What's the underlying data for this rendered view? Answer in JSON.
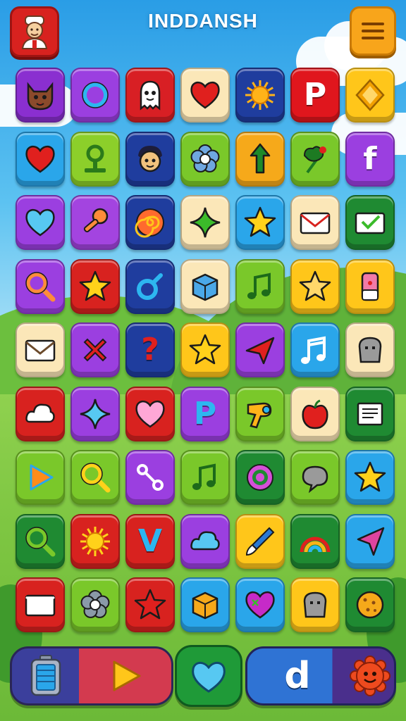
{
  "header": {
    "title": "INDDANSH",
    "avatar_icon": "chef-avatar-icon",
    "menu_icon": "hamburger-menu-icon"
  },
  "grid": {
    "rows": [
      [
        {
          "name": "cat-face",
          "bg": "#8a2fd0",
          "fg": "#8b4a2b"
        },
        {
          "name": "ring",
          "bg": "#9b3fe0",
          "fg": "#2db6f0"
        },
        {
          "name": "ghost-face",
          "bg": "#d81f24",
          "fg": "#ffffff"
        },
        {
          "name": "heart",
          "bg": "#fbe7b8",
          "fg": "#e0201e"
        },
        {
          "name": "sun",
          "bg": "#1f3d9e",
          "fg": "#ffb319"
        },
        {
          "name": "letter-p",
          "bg": "#e0161d",
          "fg": "#ffffff",
          "text": "P"
        },
        {
          "name": "diamond",
          "bg": "#ffc61a",
          "fg": "#f2a000"
        }
      ],
      [
        {
          "name": "heart",
          "bg": "#2aa6ea",
          "fg": "#e0201e"
        },
        {
          "name": "signpost",
          "bg": "#8ccf2a",
          "fg": "#2b7a1a"
        },
        {
          "name": "boy-face",
          "bg": "#1f3d9e",
          "fg": "#f1c27d"
        },
        {
          "name": "flower",
          "bg": "#7ac82a",
          "fg": "#6fa7e0"
        },
        {
          "name": "arrow-up",
          "bg": "#f6a91a",
          "fg": "#1e8a2a"
        },
        {
          "name": "rose",
          "bg": "#7ac82a",
          "fg": "#1d7a22"
        },
        {
          "name": "letter-f",
          "bg": "#9b3fe0",
          "fg": "#ffffff",
          "text": "f"
        }
      ],
      [
        {
          "name": "heart",
          "bg": "#9b3fe0",
          "fg": "#57c8f2"
        },
        {
          "name": "key",
          "bg": "#a344e0",
          "fg": "#ff8c3a"
        },
        {
          "name": "spiral",
          "bg": "#1f3d9e",
          "fg": "#ff6a2e"
        },
        {
          "name": "sparkle",
          "bg": "#fbe7b8",
          "fg": "#3bbb2a"
        },
        {
          "name": "star",
          "bg": "#2aa6ea",
          "fg": "#ffd21a"
        },
        {
          "name": "envelope",
          "bg": "#fbe7b8",
          "fg": "#d8221f"
        },
        {
          "name": "envelope-check",
          "bg": "#1f8a32",
          "fg": "#ffffff"
        }
      ],
      [
        {
          "name": "magnifier",
          "bg": "#9b3fe0",
          "fg": "#ff8c3a"
        },
        {
          "name": "star",
          "bg": "#d8221f",
          "fg": "#ffd21a"
        },
        {
          "name": "male-symbol",
          "bg": "#1f3d9e",
          "fg": "#2db6f0"
        },
        {
          "name": "box",
          "bg": "#fbe7b8",
          "fg": "#4aa8e8"
        },
        {
          "name": "music-note",
          "bg": "#7ac82a",
          "fg": "#1d6a1a"
        },
        {
          "name": "star",
          "bg": "#ffc61a",
          "fg": "#ffd76a"
        },
        {
          "name": "eraser",
          "bg": "#ffc61a",
          "fg": "#f27aa8"
        }
      ],
      [
        {
          "name": "envelope",
          "bg": "#fbe7b8",
          "fg": "#6b4a2b"
        },
        {
          "name": "cross",
          "bg": "#9b3fe0",
          "fg": "#e0201e"
        },
        {
          "name": "question",
          "bg": "#1f3d9e",
          "fg": "#e0201e",
          "text": "?"
        },
        {
          "name": "star",
          "bg": "#ffc61a",
          "fg": "#ffd21a"
        },
        {
          "name": "paper-plane",
          "bg": "#9b3fe0",
          "fg": "#e0201e"
        },
        {
          "name": "music-notes",
          "bg": "#2aa6ea",
          "fg": "#ffffff"
        },
        {
          "name": "toast",
          "bg": "#fbe7b8",
          "fg": "#9a9a9a"
        }
      ],
      [
        {
          "name": "cloud",
          "bg": "#d8221f",
          "fg": "#ffffff"
        },
        {
          "name": "sparkle",
          "bg": "#9b3fe0",
          "fg": "#57c8f2"
        },
        {
          "name": "heart",
          "bg": "#d8221f",
          "fg": "#ffa7d6"
        },
        {
          "name": "letter-p",
          "bg": "#9b3fe0",
          "fg": "#2db6f0",
          "text": "P"
        },
        {
          "name": "hairdryer",
          "bg": "#7ac82a",
          "fg": "#ffb319"
        },
        {
          "name": "apple",
          "bg": "#fbe7b8",
          "fg": "#e0201e"
        },
        {
          "name": "newspaper",
          "bg": "#1f8a32",
          "fg": "#ffffff"
        }
      ],
      [
        {
          "name": "play",
          "bg": "#7ac82a",
          "fg": "#ff8c1a"
        },
        {
          "name": "magnifier",
          "bg": "#7ac82a",
          "fg": "#ffd21a"
        },
        {
          "name": "bone-link",
          "bg": "#9b3fe0",
          "fg": "#ffffff"
        },
        {
          "name": "music-note",
          "bg": "#7ac82a",
          "fg": "#1d6a1a"
        },
        {
          "name": "target",
          "bg": "#1f8a32",
          "fg": "#d64fd8"
        },
        {
          "name": "speech-bubble",
          "bg": "#7ac82a",
          "fg": "#9a9a9a"
        },
        {
          "name": "star",
          "bg": "#2aa6ea",
          "fg": "#ffd21a"
        }
      ],
      [
        {
          "name": "magnifier",
          "bg": "#1f8a32",
          "fg": "#7ac82a"
        },
        {
          "name": "sun",
          "bg": "#d8221f",
          "fg": "#ffd21a"
        },
        {
          "name": "letter-v",
          "bg": "#d8221f",
          "fg": "#2db6f0",
          "text": "V"
        },
        {
          "name": "cloud",
          "bg": "#9b3fe0",
          "fg": "#57c8f2"
        },
        {
          "name": "brush",
          "bg": "#ffc61a",
          "fg": "#2b7ad4"
        },
        {
          "name": "rainbow",
          "bg": "#1f8a32",
          "fg": "#ffb319"
        },
        {
          "name": "arrow-cursor",
          "bg": "#2aa6ea",
          "fg": "#e0449f"
        }
      ],
      [
        {
          "name": "envelope",
          "bg": "#d8221f",
          "fg": "#ffffff"
        },
        {
          "name": "flower",
          "bg": "#7ac82a",
          "fg": "#8a9aa8"
        },
        {
          "name": "star",
          "bg": "#d8221f",
          "fg": "#e0201e"
        },
        {
          "name": "box",
          "bg": "#2aa6ea",
          "fg": "#f6a91a"
        },
        {
          "name": "heart-patch",
          "bg": "#2aa6ea",
          "fg": "#c62ac8"
        },
        {
          "name": "toast",
          "bg": "#ffc61a",
          "fg": "#9a9a9a"
        },
        {
          "name": "cookie",
          "bg": "#1f8a32",
          "fg": "#f6a91a"
        }
      ]
    ]
  },
  "bottom": {
    "items": [
      {
        "name": "battery",
        "icon": "battery-icon"
      },
      {
        "name": "play",
        "icon": "play-icon"
      },
      {
        "name": "heart",
        "icon": "heart-icon"
      },
      {
        "name": "letter-d",
        "icon": "letter-d-icon",
        "text": "d"
      },
      {
        "name": "gear-face",
        "icon": "smiling-gear-icon"
      }
    ],
    "colors": {
      "left": "#3b3f9c",
      "play_bg": "#d33a4f",
      "mid": "#1f9a38",
      "right": "#2f73d4",
      "end": "#4a2f8c"
    }
  }
}
